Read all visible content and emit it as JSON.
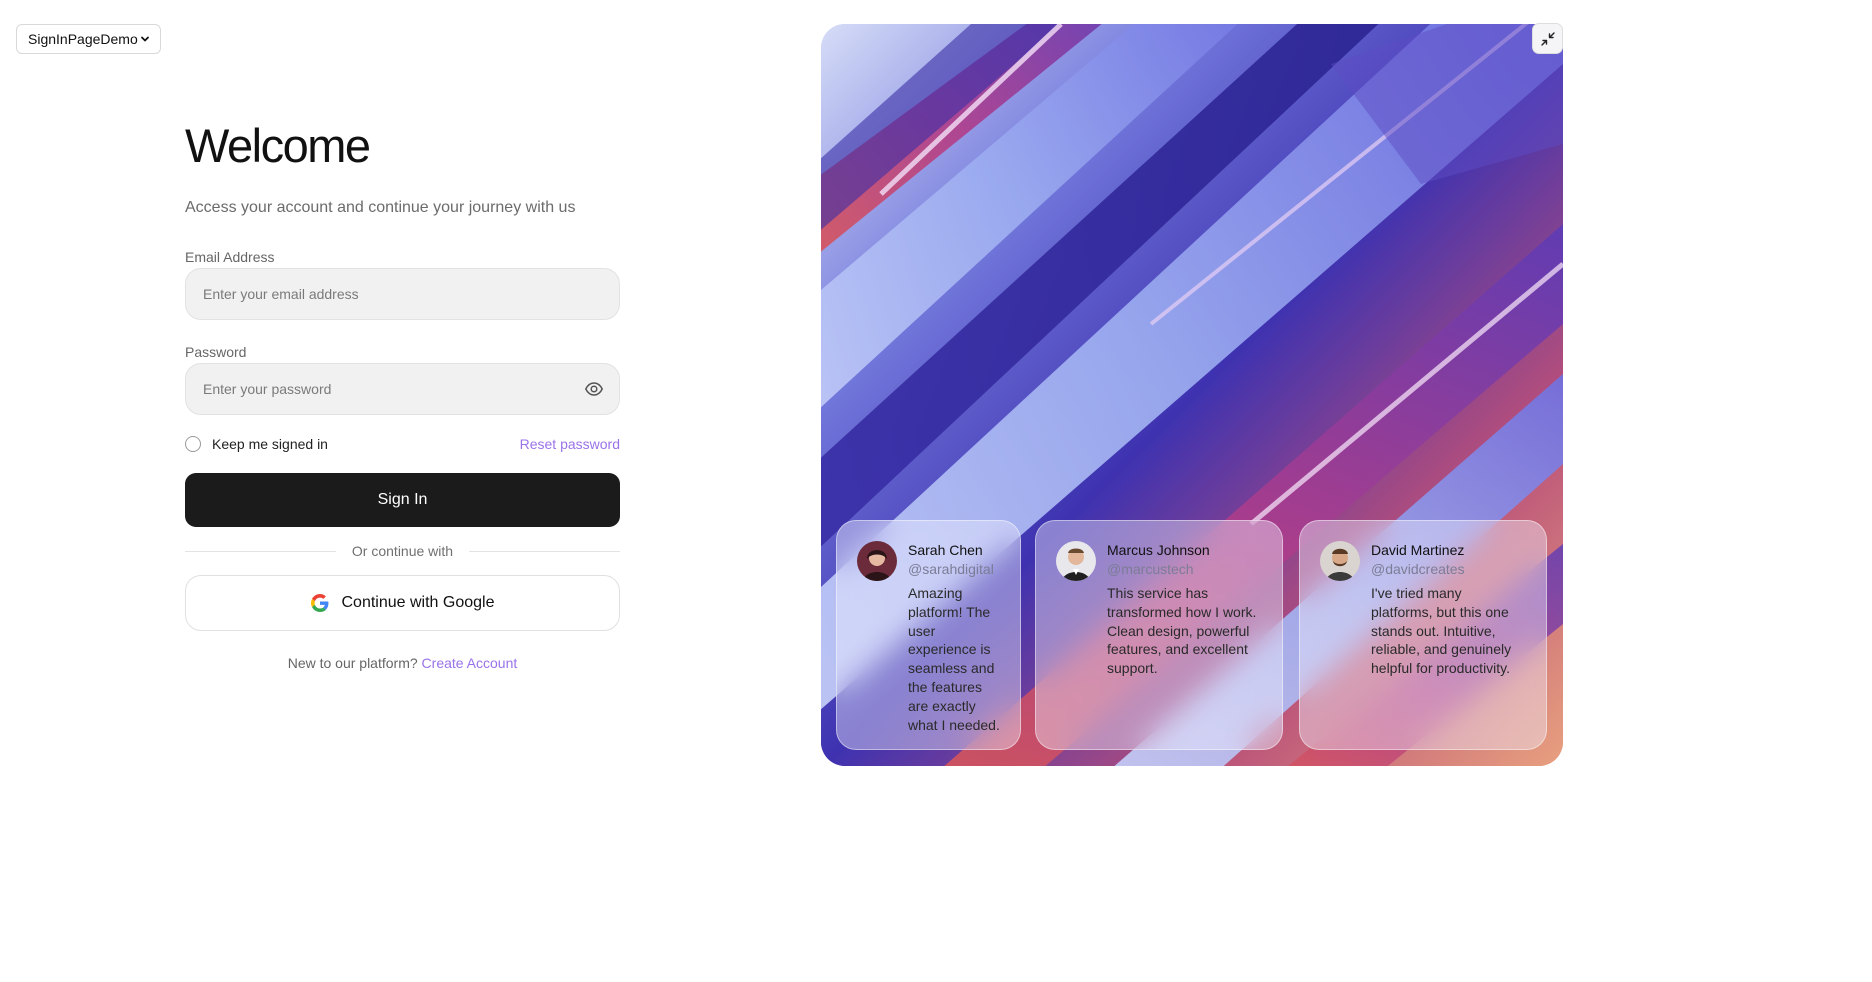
{
  "demo_select": {
    "value": "SignInPageDemo"
  },
  "form": {
    "title": "Welcome",
    "subtitle": "Access your account and continue your journey with us",
    "email_label": "Email Address",
    "email_placeholder": "Enter your email address",
    "password_label": "Password",
    "password_placeholder": "Enter your password",
    "keep_signed_in": "Keep me signed in",
    "reset_password": "Reset password",
    "sign_in": "Sign In",
    "divider": "Or continue with",
    "google": "Continue with Google",
    "new_prompt": "New to our platform?",
    "create_account": "Create Account"
  },
  "testimonials": [
    {
      "name": "Sarah Chen",
      "handle": "@sarahdigital",
      "text": "Amazing platform! The user experience is seamless and the features are exactly what I needed."
    },
    {
      "name": "Marcus Johnson",
      "handle": "@marcustech",
      "text": "This service has transformed how I work. Clean design, powerful features, and excellent support."
    },
    {
      "name": "David Martinez",
      "handle": "@davidcreates",
      "text": "I've tried many platforms, but this one stands out. Intuitive, reliable, and genuinely helpful for productivity."
    }
  ],
  "colors": {
    "accent": "#9a72e8",
    "primary_button": "#1b1b1b"
  },
  "icons": {
    "collapse": "collapse-icon",
    "eye": "eye-icon",
    "google": "google-icon",
    "chevron": "chevron-down-icon"
  }
}
